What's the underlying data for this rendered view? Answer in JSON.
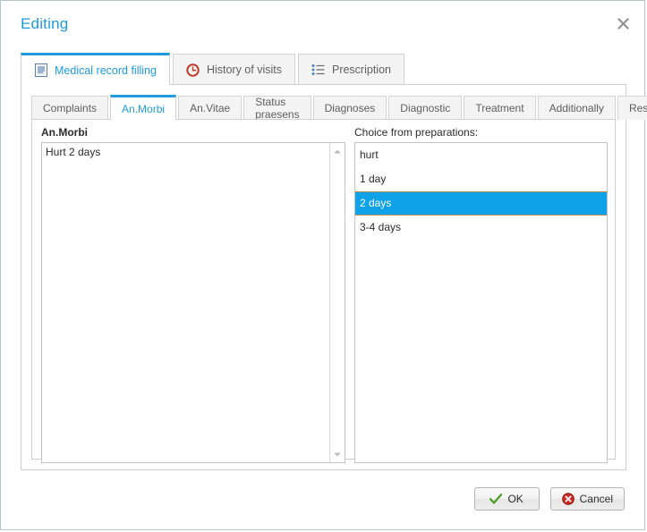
{
  "window": {
    "title": "Editing",
    "close_icon": "close-icon"
  },
  "outer_tabs": [
    {
      "label": "Medical record filling",
      "icon": "document-lines-icon",
      "active": true
    },
    {
      "label": "History of visits",
      "icon": "history-clock-icon",
      "active": false
    },
    {
      "label": "Prescription",
      "icon": "bulleted-list-icon",
      "active": false
    }
  ],
  "inner_tabs": [
    {
      "label": "Complaints",
      "active": false
    },
    {
      "label": "An.Morbi",
      "active": true
    },
    {
      "label": "An.Vitae",
      "active": false
    },
    {
      "label": "Status praesens",
      "active": false
    },
    {
      "label": "Diagnoses",
      "active": false
    },
    {
      "label": "Diagnostic",
      "active": false
    },
    {
      "label": "Treatment",
      "active": false
    },
    {
      "label": "Additionally",
      "active": false
    },
    {
      "label": "Result",
      "active": false
    }
  ],
  "left_panel": {
    "label": "An.Morbi",
    "textarea_value": "Hurt 2 days",
    "scroll_up_icon": "chevron-up-icon",
    "scroll_down_icon": "chevron-down-icon"
  },
  "right_panel": {
    "label": "Choice from preparations:",
    "items": [
      {
        "text": "hurt",
        "selected": false
      },
      {
        "text": "1 day",
        "selected": false
      },
      {
        "text": "2 days",
        "selected": true
      },
      {
        "text": "3-4 days",
        "selected": false
      }
    ]
  },
  "footer": {
    "ok_label": "OK",
    "ok_icon": "green-check-icon",
    "cancel_label": "Cancel",
    "cancel_icon": "red-x-circle-icon"
  },
  "colors": {
    "accent": "#1f9bdd",
    "selection": "#10a2e8",
    "selection_border": "#c08a4c",
    "text": "#2b2b2b",
    "border": "#cfcfcf"
  }
}
